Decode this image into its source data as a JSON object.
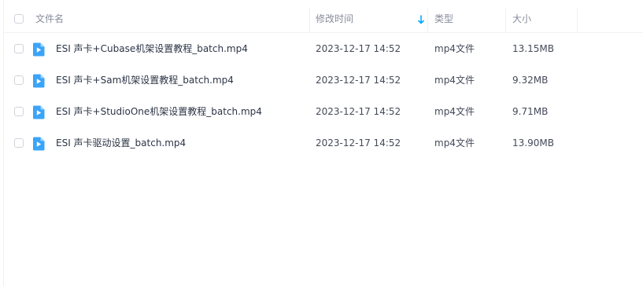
{
  "header": {
    "name_label": "文件名",
    "modified_label": "修改时间",
    "type_label": "类型",
    "size_label": "大小",
    "sort_icon": "sort-descending-arrow-icon",
    "accent_color": "#06a7ff"
  },
  "files": [
    {
      "name": "ESI 声卡+Cubase机架设置教程_batch.mp4",
      "modified": "2023-12-17 14:52",
      "type": "mp4文件",
      "size": "13.15MB",
      "icon": "video-file-icon"
    },
    {
      "name": "ESI 声卡+Sam机架设置教程_batch.mp4",
      "modified": "2023-12-17 14:52",
      "type": "mp4文件",
      "size": "9.32MB",
      "icon": "video-file-icon"
    },
    {
      "name": "ESI 声卡+StudioOne机架设置教程_batch.mp4",
      "modified": "2023-12-17 14:52",
      "type": "mp4文件",
      "size": "9.71MB",
      "icon": "video-file-icon"
    },
    {
      "name": "ESI 声卡驱动设置_batch.mp4",
      "modified": "2023-12-17 14:52",
      "type": "mp4文件",
      "size": "13.90MB",
      "icon": "video-file-icon"
    }
  ]
}
